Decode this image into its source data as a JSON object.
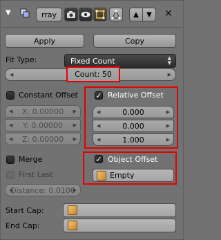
{
  "header": {
    "collapse_glyph": "▼",
    "modifier_icon": "array-modifier-icon",
    "name": "rray",
    "close_glyph": "✕",
    "up_glyph": "▲",
    "down_glyph": "▼"
  },
  "actions": {
    "apply": "Apply",
    "copy": "Copy"
  },
  "fit": {
    "label": "Fit Type:",
    "value": "Fixed Count"
  },
  "count": {
    "label": "Count: 50"
  },
  "constant_offset": {
    "label": "Constant Offset",
    "checked": false,
    "x": "X: 0.00000",
    "y": "Y: 0.00000",
    "z": "Z: 0.00000"
  },
  "relative_offset": {
    "label": "Relative Offset",
    "checked": true,
    "values": [
      "0.000",
      "0.000",
      "1.000"
    ]
  },
  "merge": {
    "label": "Merge",
    "checked": false
  },
  "first_last": {
    "label": "First Last",
    "checked": false
  },
  "distance": {
    "label": "Distance: 0.0100"
  },
  "object_offset": {
    "label": "Object Offset",
    "checked": true,
    "object": "Empty"
  },
  "caps": {
    "start": "Start Cap:",
    "end": "End Cap:"
  },
  "colors": {
    "highlight": "#e40000",
    "panel": "#727272"
  }
}
